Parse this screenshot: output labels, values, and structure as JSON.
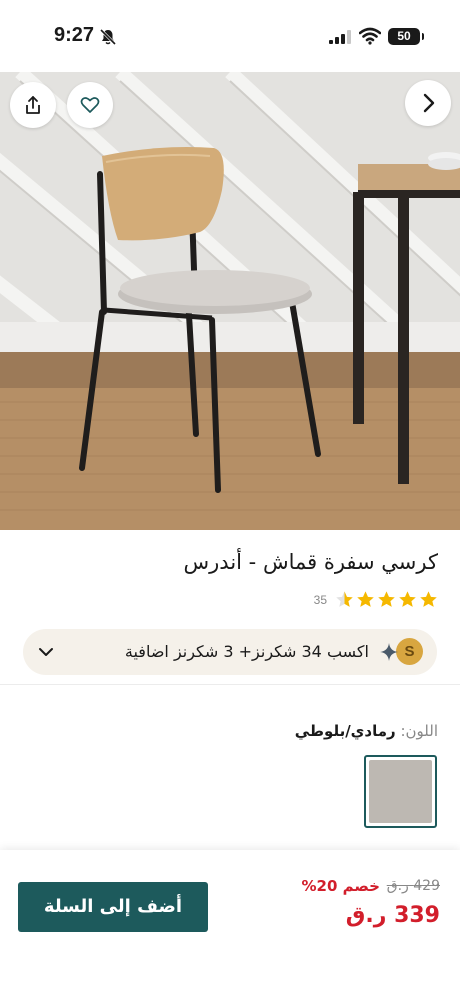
{
  "status_bar": {
    "time": "9:27",
    "battery": "50"
  },
  "hero": {
    "image_alt": "chair-photo",
    "icons": {
      "share": "share-icon",
      "favorite": "heart-icon",
      "next": "chevron-right-icon"
    }
  },
  "product": {
    "title": "كرسي سفرة قماش - أندرس",
    "rating_stars": 4.5,
    "rating_count": "35"
  },
  "points": {
    "text": "اكسب 34 شكرنز+  3 شكرنز اضافية",
    "coin_label": "S"
  },
  "color": {
    "label": "اللون:",
    "value": "رمادي/بلوطي"
  },
  "footer": {
    "add_to_cart": "أضف إلى السلة",
    "old_price": "429 ر.ق",
    "discount": "خصم 20%",
    "new_price": "339 ر.ق"
  },
  "colors": {
    "brand": "#1d5a5c",
    "sale": "#d21e2b",
    "star": "#f5b800"
  }
}
